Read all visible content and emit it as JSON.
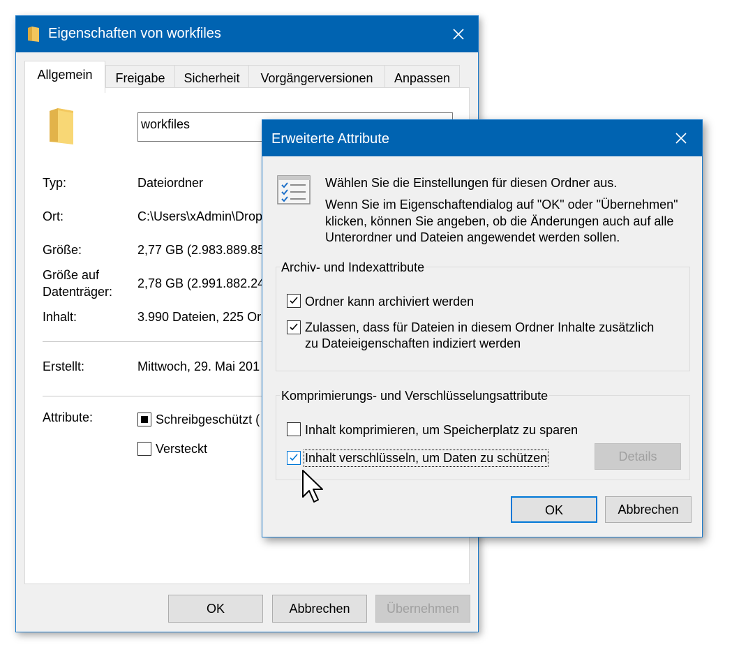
{
  "main_window": {
    "title": "Eigenschaften von workfiles",
    "tabs": [
      "Allgemein",
      "Freigabe",
      "Sicherheit",
      "Vorgängerversionen",
      "Anpassen"
    ],
    "folder_name": "workfiles",
    "props": {
      "type_label": "Typ:",
      "type_value": "Dateiordner",
      "location_label": "Ort:",
      "location_value": "C:\\Users\\xAdmin\\Drop",
      "size_label": "Größe:",
      "size_value": "2,77 GB (2.983.889.85",
      "disk_size_label_1": "Größe auf",
      "disk_size_label_2": "Datenträger:",
      "disk_size_value": "2,78 GB (2.991.882.24",
      "contents_label": "Inhalt:",
      "contents_value": "3.990 Dateien, 225 Or",
      "created_label": "Erstellt:",
      "created_value": "Mittwoch, 29. Mai 201",
      "attributes_label": "Attribute:",
      "readonly_label": "Schreibgeschützt (",
      "hidden_label": "Versteckt"
    },
    "buttons": {
      "ok": "OK",
      "cancel": "Abbrechen",
      "apply": "Übernehmen"
    }
  },
  "advanced_dialog": {
    "title": "Erweiterte Attribute",
    "intro_1": "Wählen Sie die Einstellungen für diesen Ordner aus.",
    "intro_2": "Wenn Sie im Eigenschaftendialog auf \"OK\" oder \"Übernehmen\"",
    "intro_3": "klicken, können Sie angeben, ob die Änderungen auch auf alle",
    "intro_4": "Unterordner und Dateien angewendet werden sollen.",
    "archive_group": {
      "label": "Archiv- und Indexattribute",
      "archive_checkbox": "Ordner kann archiviert werden",
      "archive_checked": true,
      "index_checkbox_line1": "Zulassen, dass für Dateien in diesem Ordner Inhalte zusätzlich",
      "index_checkbox_line2": "zu Dateieigenschaften indiziert werden",
      "index_checked": true
    },
    "compress_group": {
      "label": "Komprimierungs- und Verschlüsselungsattribute",
      "compress_checkbox": "Inhalt komprimieren, um Speicherplatz zu sparen",
      "compress_checked": false,
      "encrypt_checkbox": "Inhalt verschlüsseln, um Daten zu schützen",
      "encrypt_checked": true,
      "details_button": "Details"
    },
    "buttons": {
      "ok": "OK",
      "cancel": "Abbrechen"
    }
  },
  "colors": {
    "titlebar": "#0063b1",
    "accent": "#0078d7",
    "folder": "#f8d775"
  }
}
